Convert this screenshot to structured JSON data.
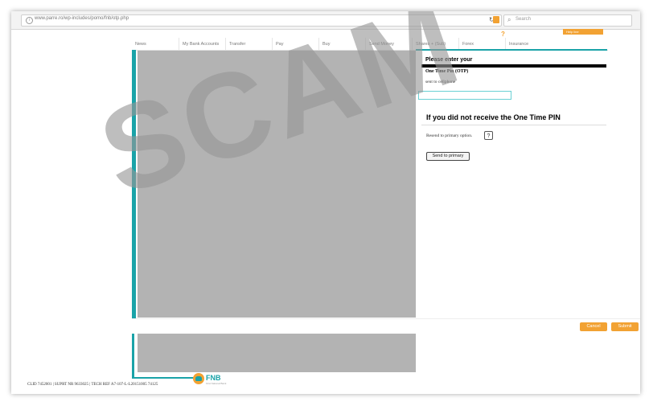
{
  "browser": {
    "url": "www.parre.ro/wp-includes/pomo/fnb/otp.php",
    "search_placeholder": "Search",
    "icons": {
      "back": "back-arrow-icon",
      "forward": "forward-arrow-icon",
      "info": "info-icon",
      "reload": "reload-icon",
      "search": "search-icon"
    }
  },
  "header": {
    "help_glyph": "?",
    "orange_tab_label": "Help line"
  },
  "nav": {
    "items": [
      {
        "label": "News"
      },
      {
        "label": "My Bank Accounts"
      },
      {
        "label": "Transfer"
      },
      {
        "label": "Pay"
      },
      {
        "label": "Buy"
      },
      {
        "label": "Send Money"
      },
      {
        "label": "Shares + (Sub)"
      },
      {
        "label": "Forex"
      },
      {
        "label": "Insurance"
      }
    ]
  },
  "otp": {
    "heading": "Please enter your",
    "label": "One Time Pin (OTP)",
    "subtext": "sent to cellphone",
    "input_value": ""
  },
  "resend": {
    "heading": "If you did not receive the One Time PIN",
    "text": "Resend to primary option.",
    "help_glyph": "?",
    "button_label": "Send to primary"
  },
  "actions": {
    "cancel_label": "Cancel",
    "submit_label": "Submit"
  },
  "footer": {
    "logo_text": "FNB",
    "logo_tagline": "First National Bank",
    "info": "CLID 7452001 | SUPRT NR 9633025 | TECH REF A7-107-L-L20151005 74125"
  },
  "watermark": "SCAM",
  "colors": {
    "teal": "#1aa3a8",
    "orange": "#f2a233",
    "placeholder_gray": "#b3b3b3"
  }
}
